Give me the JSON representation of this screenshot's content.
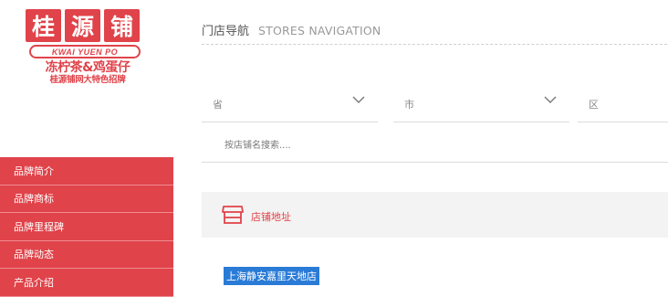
{
  "logo": {
    "chars": [
      "桂",
      "源",
      "铺"
    ],
    "latin": "KWAI YUEN PO",
    "slogan": "冻柠茶&鸡蛋仔",
    "sub": "桂源铺网大特色招牌"
  },
  "sidebar": {
    "items": [
      {
        "label": "品牌简介"
      },
      {
        "label": "品牌商标"
      },
      {
        "label": "品牌里程碑"
      },
      {
        "label": "品牌动态"
      },
      {
        "label": "产品介绍"
      }
    ]
  },
  "header": {
    "title_cn": "门店导航",
    "title_en": "STORES NAVIGATION"
  },
  "filters": {
    "province": "省",
    "city": "市",
    "district": "区"
  },
  "search": {
    "placeholder": "按店铺名搜索...."
  },
  "address_section": {
    "label": "店铺地址"
  },
  "results": {
    "first": "上海静安嘉里天地店"
  },
  "colors": {
    "brand_red": "#e0434a",
    "highlight_blue": "#2a7bd6"
  }
}
